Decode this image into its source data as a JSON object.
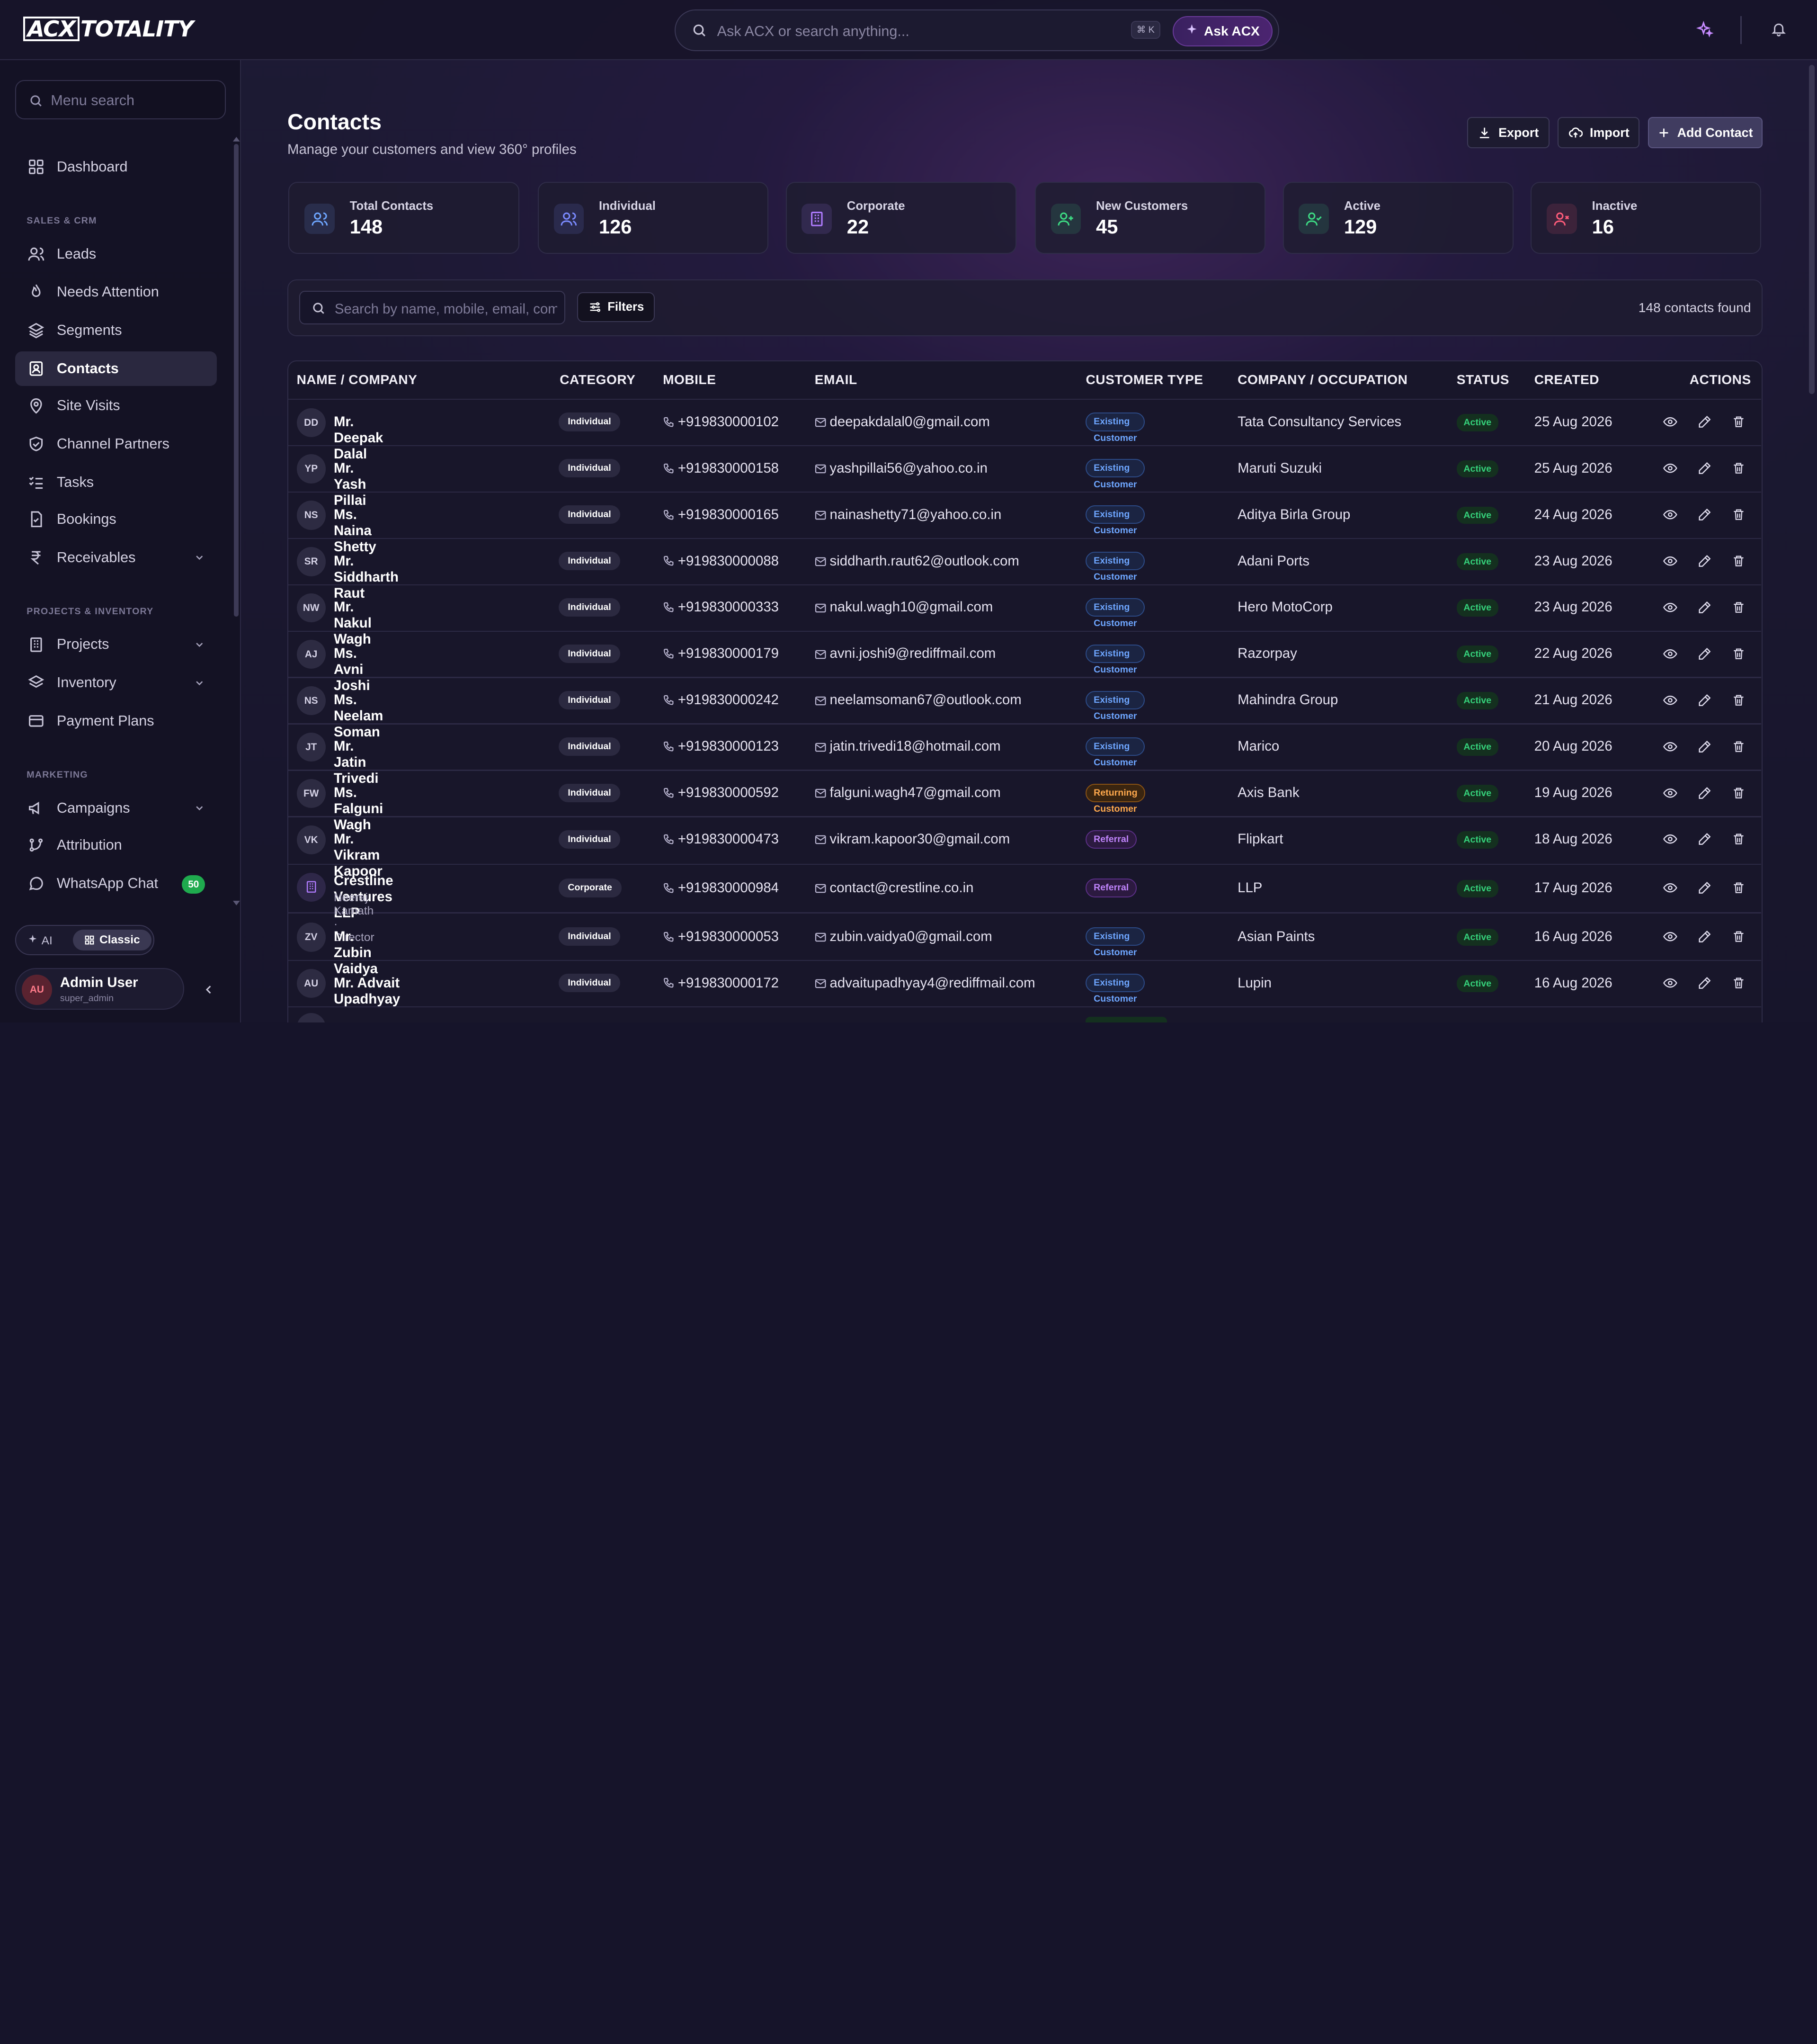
{
  "app": {
    "logo": "ACX TOTALITY",
    "logo_boxed": "ACX",
    "logo_rest": "TOTALITY"
  },
  "topbar": {
    "search_placeholder": "Ask ACX or search anything...",
    "shortcut": "⌘ K",
    "ask_label": "Ask ACX"
  },
  "sidebar": {
    "search_placeholder": "Menu search",
    "dashboard": "Dashboard",
    "sections": {
      "sales": "SALES & CRM",
      "projects": "PROJECTS & INVENTORY",
      "marketing": "MARKETING"
    },
    "sales_items": [
      "Leads",
      "Needs Attention",
      "Segments",
      "Contacts",
      "Site Visits",
      "Channel Partners",
      "Tasks",
      "Bookings",
      "Receivables"
    ],
    "project_items": [
      "Projects",
      "Inventory",
      "Payment Plans"
    ],
    "marketing_items": [
      "Campaigns",
      "Attribution",
      "WhatsApp Chat"
    ],
    "whatsapp_badge": "50",
    "active_item": "Contacts",
    "mode": {
      "ai": "AI",
      "classic": "Classic",
      "selected": "Classic"
    },
    "user": {
      "initials": "AU",
      "name": "Admin User",
      "role": "super_admin"
    }
  },
  "page": {
    "title": "Contacts",
    "subtitle": "Manage your customers and view 360° profiles",
    "export_label": "Export",
    "import_label": "Import",
    "add_label": "Add Contact"
  },
  "stats": [
    {
      "label": "Total Contacts",
      "value": "148",
      "color": "#6ea6ff"
    },
    {
      "label": "Individual",
      "value": "126",
      "color": "#7b8bff"
    },
    {
      "label": "Corporate",
      "value": "22",
      "color": "#b07cff"
    },
    {
      "label": "New Customers",
      "value": "45",
      "color": "#3ddc84"
    },
    {
      "label": "Active",
      "value": "129",
      "color": "#3ddc84"
    },
    {
      "label": "Inactive",
      "value": "16",
      "color": "#ff5c7a"
    }
  ],
  "filters": {
    "search_placeholder": "Search by name, mobile, email, company...",
    "filters_label": "Filters",
    "found": "148 contacts found"
  },
  "table": {
    "headers": [
      "NAME / COMPANY",
      "CATEGORY",
      "MOBILE",
      "EMAIL",
      "CUSTOMER TYPE",
      "COMPANY / OCCUPATION",
      "STATUS",
      "CREATED",
      "ACTIONS"
    ],
    "rows": [
      {
        "initials": "DD",
        "name": "Mr. Deepak Dalal",
        "category": "Individual",
        "mobile": "+919830000102",
        "email": "deepakdalal0@gmail.com",
        "type": "Existing Customer",
        "company": "Tata Consultancy Services",
        "status": "Active",
        "created": "25 Aug 2026"
      },
      {
        "initials": "YP",
        "name": "Mr. Yash Pillai",
        "category": "Individual",
        "mobile": "+919830000158",
        "email": "yashpillai56@yahoo.co.in",
        "type": "Existing Customer",
        "company": "Maruti Suzuki",
        "status": "Active",
        "created": "25 Aug 2026"
      },
      {
        "initials": "NS",
        "name": "Ms. Naina Shetty",
        "category": "Individual",
        "mobile": "+919830000165",
        "email": "nainashetty71@yahoo.co.in",
        "type": "Existing Customer",
        "company": "Aditya Birla Group",
        "status": "Active",
        "created": "24 Aug 2026"
      },
      {
        "initials": "SR",
        "name": "Mr. Siddharth Raut",
        "category": "Individual",
        "mobile": "+919830000088",
        "email": "siddharth.raut62@outlook.com",
        "type": "Existing Customer",
        "company": "Adani Ports",
        "status": "Active",
        "created": "23 Aug 2026"
      },
      {
        "initials": "NW",
        "name": "Mr. Nakul Wagh",
        "category": "Individual",
        "mobile": "+919830000333",
        "email": "nakul.wagh10@gmail.com",
        "type": "Existing Customer",
        "company": "Hero MotoCorp",
        "status": "Active",
        "created": "23 Aug 2026"
      },
      {
        "initials": "AJ",
        "name": "Ms. Avni Joshi",
        "category": "Individual",
        "mobile": "+919830000179",
        "email": "avni.joshi9@rediffmail.com",
        "type": "Existing Customer",
        "company": "Razorpay",
        "status": "Active",
        "created": "22 Aug 2026"
      },
      {
        "initials": "NS",
        "name": "Ms. Neelam Soman",
        "category": "Individual",
        "mobile": "+919830000242",
        "email": "neelamsoman67@outlook.com",
        "type": "Existing Customer",
        "company": "Mahindra Group",
        "status": "Active",
        "created": "21 Aug 2026"
      },
      {
        "initials": "JT",
        "name": "Mr. Jatin Trivedi",
        "category": "Individual",
        "mobile": "+919830000123",
        "email": "jatin.trivedi18@hotmail.com",
        "type": "Existing Customer",
        "company": "Marico",
        "status": "Active",
        "created": "20 Aug 2026"
      },
      {
        "initials": "FW",
        "name": "Ms. Falguni Wagh",
        "category": "Individual",
        "mobile": "+919830000592",
        "email": "falguni.wagh47@gmail.com",
        "type": "Returning Customer",
        "company": "Axis Bank",
        "status": "Active",
        "created": "19 Aug 2026"
      },
      {
        "initials": "VK",
        "name": "Mr. Vikram Kapoor",
        "category": "Individual",
        "mobile": "+919830000473",
        "email": "vikram.kapoor30@gmail.com",
        "type": "Referral",
        "company": "Flipkart",
        "status": "Active",
        "created": "18 Aug 2026"
      },
      {
        "initials": "",
        "name": "Crestline Ventures LLP",
        "contact": "Neeraj Kamath · Director",
        "category": "Corporate",
        "mobile": "+919830000984",
        "email": "contact@crestline.co.in",
        "type": "Referral",
        "company": "LLP",
        "status": "Active",
        "created": "17 Aug 2026"
      },
      {
        "initials": "ZV",
        "name": "Mr. Zubin Vaidya",
        "category": "Individual",
        "mobile": "+919830000053",
        "email": "zubin.vaidya0@gmail.com",
        "type": "Existing Customer",
        "company": "Asian Paints",
        "status": "Active",
        "created": "16 Aug 2026"
      },
      {
        "initials": "AU",
        "name": "Mr. Advait Upadhyay",
        "category": "Individual",
        "mobile": "+919830000172",
        "email": "advaitupadhyay4@rediffmail.com",
        "type": "Existing Customer",
        "company": "Lupin",
        "status": "Active",
        "created": "16 Aug 2026"
      }
    ]
  }
}
